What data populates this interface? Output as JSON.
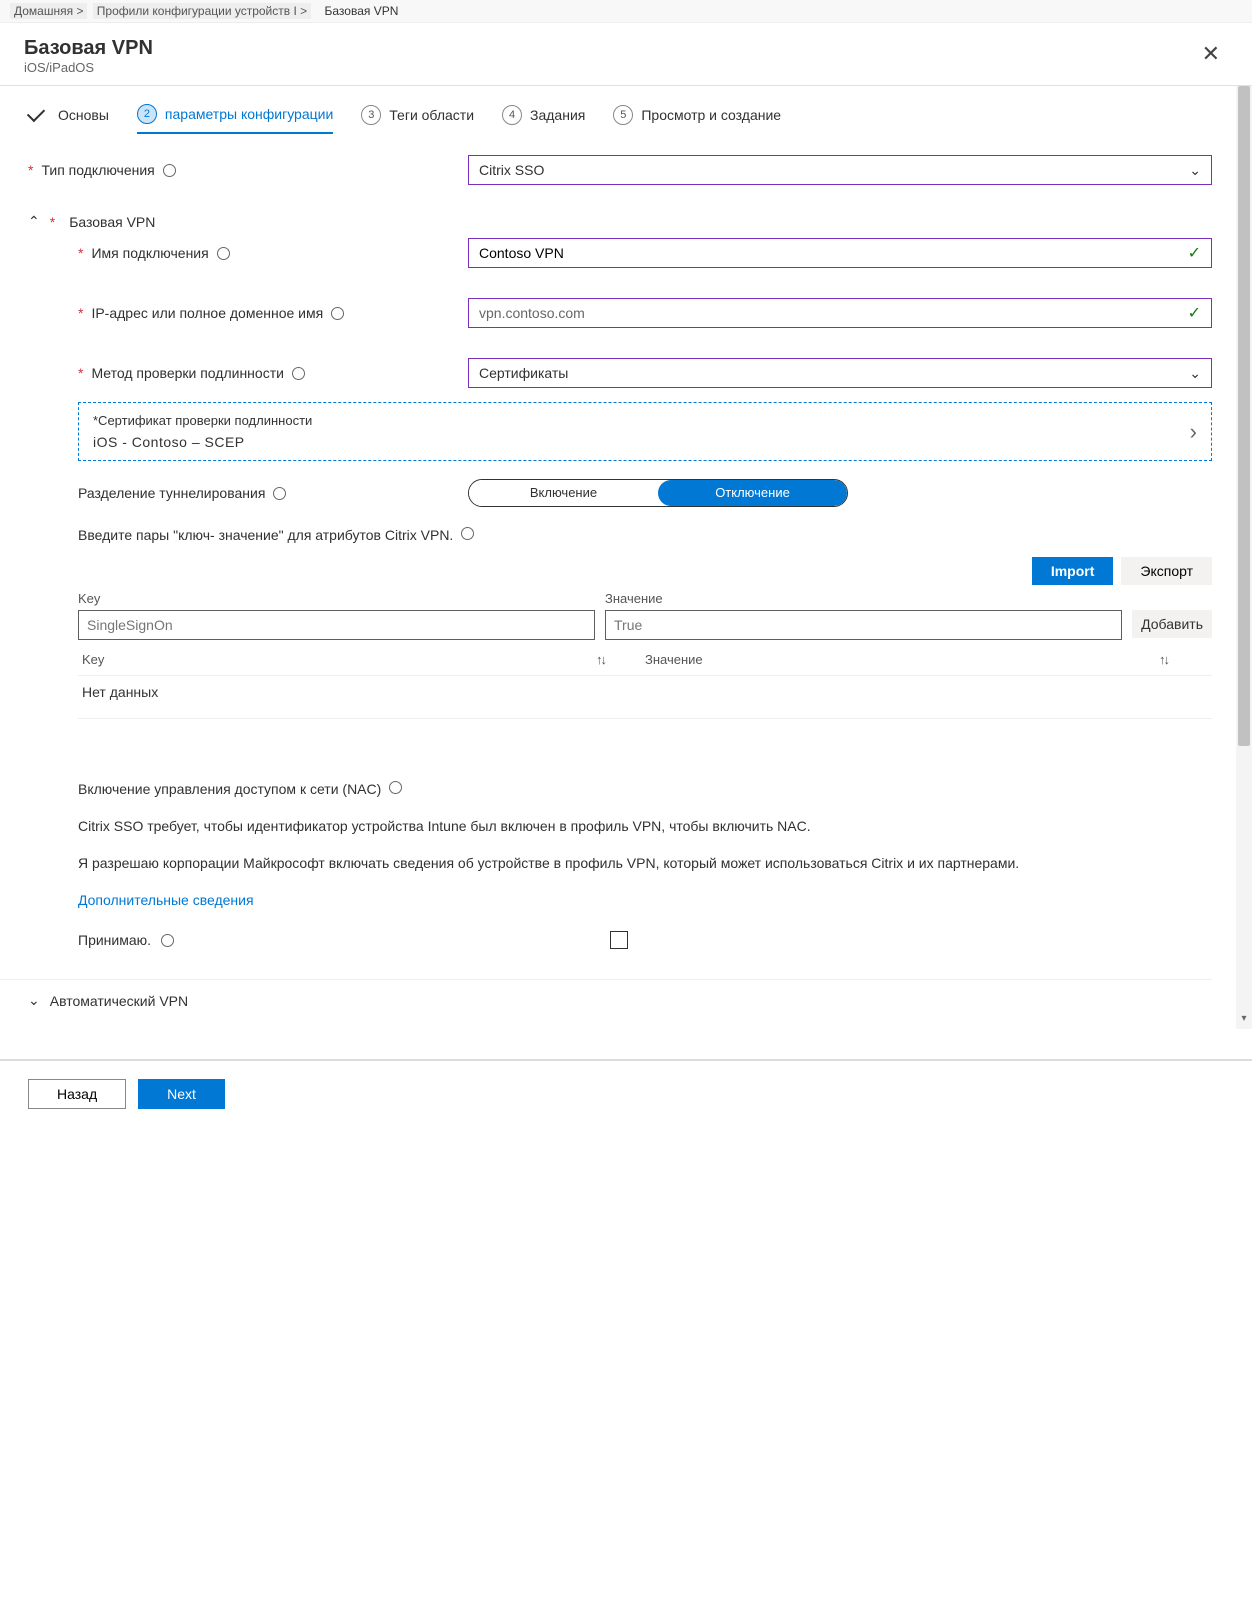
{
  "breadcrumb": {
    "home": "Домашняя >",
    "profiles": "Профили конфигурации устройств I >",
    "current": "Базовая VPN"
  },
  "panel": {
    "title": "Базовая VPN",
    "subtitle": "iOS/iPadOS"
  },
  "steps": {
    "s1": "Основы",
    "s2": "параметры конфигурации",
    "s3": "Теги области",
    "s4": "Задания",
    "s5": "Просмотр и создание",
    "n2": "2",
    "n3": "3",
    "n4": "4",
    "n5": "5"
  },
  "connType": {
    "label": "Тип подключения",
    "value": "Citrix SSO"
  },
  "baseVpn": {
    "header": "Базовая VPN"
  },
  "connName": {
    "label": "Имя подключения",
    "value": "Contoso VPN"
  },
  "ip": {
    "label": "IP-адрес или полное доменное имя",
    "value": "vpn.contoso.com"
  },
  "auth": {
    "label": "Метод проверки подлинности",
    "value": "Сертификаты"
  },
  "cert": {
    "label": "*Сертификат проверки подлинности",
    "value": "iOS  -  Contoso –    SCEP"
  },
  "split": {
    "label": "Разделение туннелирования",
    "on": "Включение",
    "off": "Отключение"
  },
  "kv": {
    "intro": "Введите пары \"ключ- значение\" для атрибутов Citrix VPN.",
    "import": "Import",
    "export": "Экспорт",
    "keyLabel": "Key",
    "valLabel": "Значение",
    "add": "Добавить",
    "keyPh": "SingleSignOn",
    "valPh": "True",
    "tblKey": "Key",
    "tblVal": "Значение",
    "empty": "Нет данных"
  },
  "nac": {
    "title": "Включение управления доступом к сети (NAC)",
    "p1": "Citrix SSO требует, чтобы идентификатор устройства Intune был включен в профиль VPN, чтобы включить NAC.",
    "p2": "Я разрешаю корпорации Майкрософт включать сведения об устройстве в профиль VPN, который может использоваться Citrix и их партнерами.",
    "more": "Дополнительные сведения",
    "agree": "Принимаю."
  },
  "autoVpn": "Автоматический VPN",
  "footer": {
    "back": "Назад",
    "next": "Next"
  }
}
